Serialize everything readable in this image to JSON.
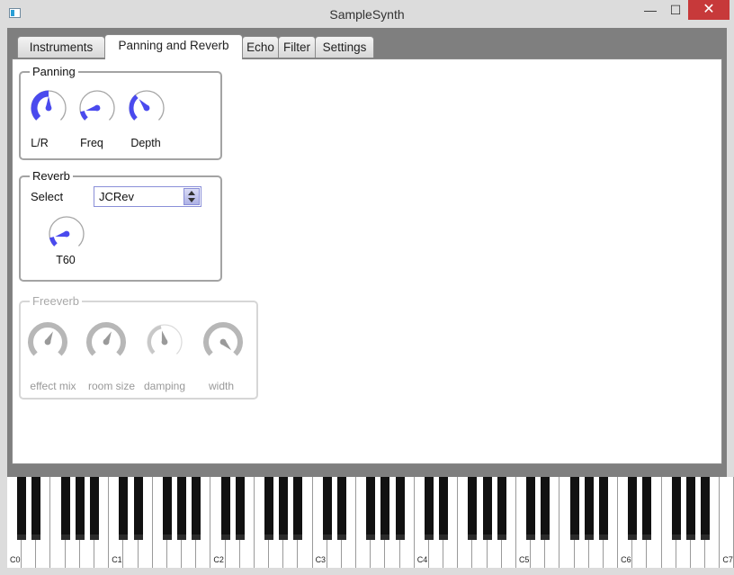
{
  "window": {
    "title": "SampleSynth",
    "minimize_glyph": "—",
    "maximize_glyph": "☐",
    "close_glyph": "✕"
  },
  "tabs": [
    {
      "label": "Instruments",
      "active": false
    },
    {
      "label": "Panning and Reverb",
      "active": true
    },
    {
      "label": "Echo",
      "active": false
    },
    {
      "label": "Filter",
      "active": false
    },
    {
      "label": "Settings",
      "active": false
    }
  ],
  "panning": {
    "title": "Panning",
    "knobs": [
      {
        "label": "L/R",
        "value": 0.5
      },
      {
        "label": "Freq",
        "value": 0.12
      },
      {
        "label": "Depth",
        "value": 0.35
      }
    ]
  },
  "reverb": {
    "title": "Reverb",
    "select_label": "Select",
    "selected": "JCRev",
    "knob": {
      "label": "T60",
      "value": 0.12
    }
  },
  "freeverb": {
    "title": "Freeverb",
    "enabled": false,
    "knobs": [
      {
        "label": "effect mix",
        "value": 0.6
      },
      {
        "label": "room size",
        "value": 0.6
      },
      {
        "label": "damping",
        "value": 0.45
      },
      {
        "label": "width",
        "value": 1.0
      }
    ]
  },
  "keyboard": {
    "octave_labels": [
      "C0",
      "C1",
      "C2",
      "C3",
      "C4",
      "C5",
      "C6",
      "C7"
    ]
  },
  "colors": {
    "knob_fill": "#4a4aee",
    "knob_disabled": "#b7b7b7",
    "knob_ring": "#a6a6a6"
  }
}
